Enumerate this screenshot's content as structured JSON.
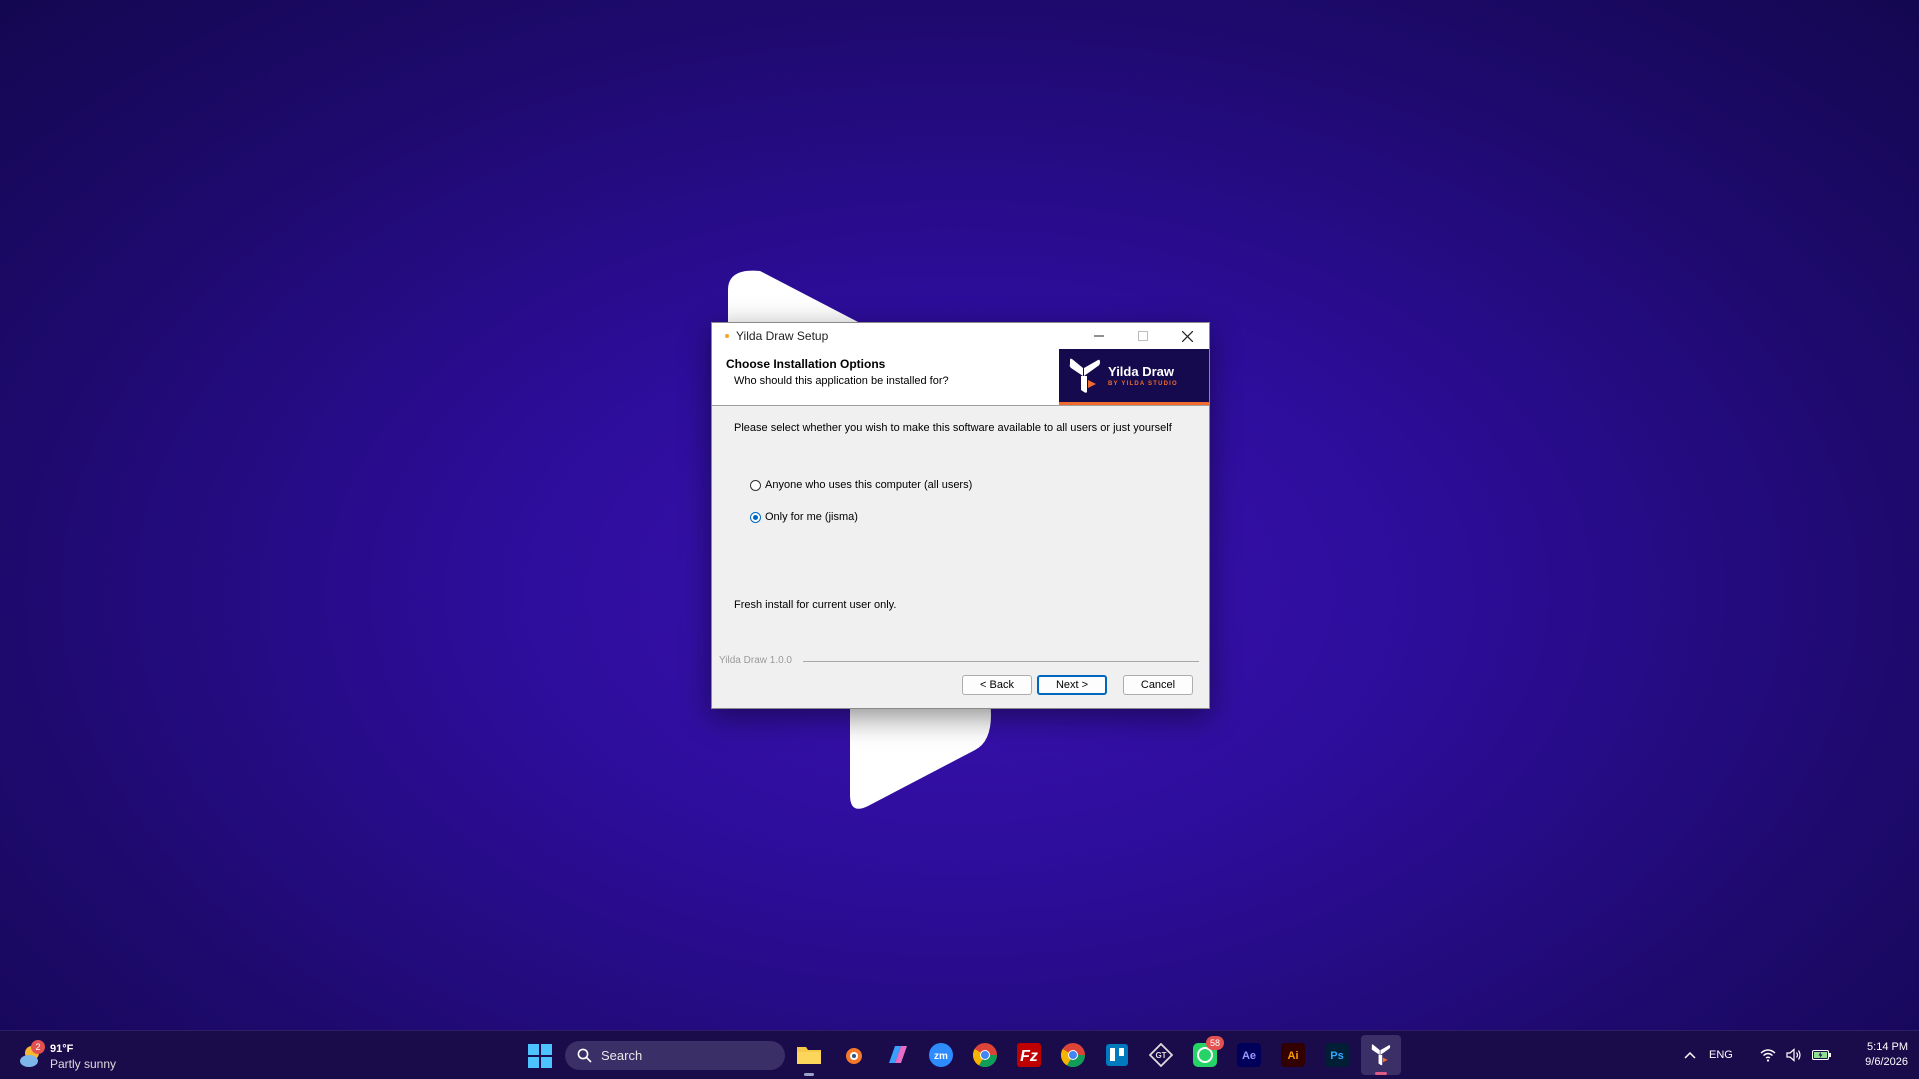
{
  "window": {
    "title": "Yilda Draw Setup"
  },
  "header": {
    "title": "Choose Installation Options",
    "subtitle": "Who should this application be installed for?",
    "banner_name": "Yilda Draw",
    "banner_by": "BY YILDA STUDIO"
  },
  "body": {
    "intro": "Please select whether you wish to make this software available to all users or just yourself",
    "options": [
      {
        "label": "Anyone who uses this computer (all users)",
        "selected": false
      },
      {
        "label": "Only for me (jisma)",
        "selected": true
      }
    ],
    "status": "Fresh install for current user only."
  },
  "footer": {
    "brand": "Yilda Draw 1.0.0",
    "back_label": "< Back",
    "next_label": "Next >",
    "cancel_label": "Cancel"
  },
  "taskbar": {
    "weather_temp": "91°F",
    "weather_desc": "Partly sunny",
    "weather_badge": "2",
    "search_placeholder": "Search",
    "apps": [
      {
        "name": "file-explorer-icon"
      },
      {
        "name": "blender-icon"
      },
      {
        "name": "copilot-icon"
      },
      {
        "name": "zoom-icon"
      },
      {
        "name": "chrome-icon"
      },
      {
        "name": "filezilla-icon"
      },
      {
        "name": "chrome-icon"
      },
      {
        "name": "trello-icon"
      },
      {
        "name": "gt-app-icon"
      },
      {
        "name": "whatsapp-icon",
        "badge": "58"
      },
      {
        "name": "after-effects-icon"
      },
      {
        "name": "illustrator-icon"
      },
      {
        "name": "photoshop-icon"
      },
      {
        "name": "yilda-draw-icon",
        "active": true
      }
    ],
    "whatsapp_badge": "58",
    "language": "ENG",
    "time": "5:14 PM",
    "date": "9/6/2026"
  },
  "colors": {
    "accent": "#0067c0",
    "brand_orange": "#f06b2d",
    "banner_bg": "#140a4d",
    "wallpaper": "#2c0d99"
  }
}
